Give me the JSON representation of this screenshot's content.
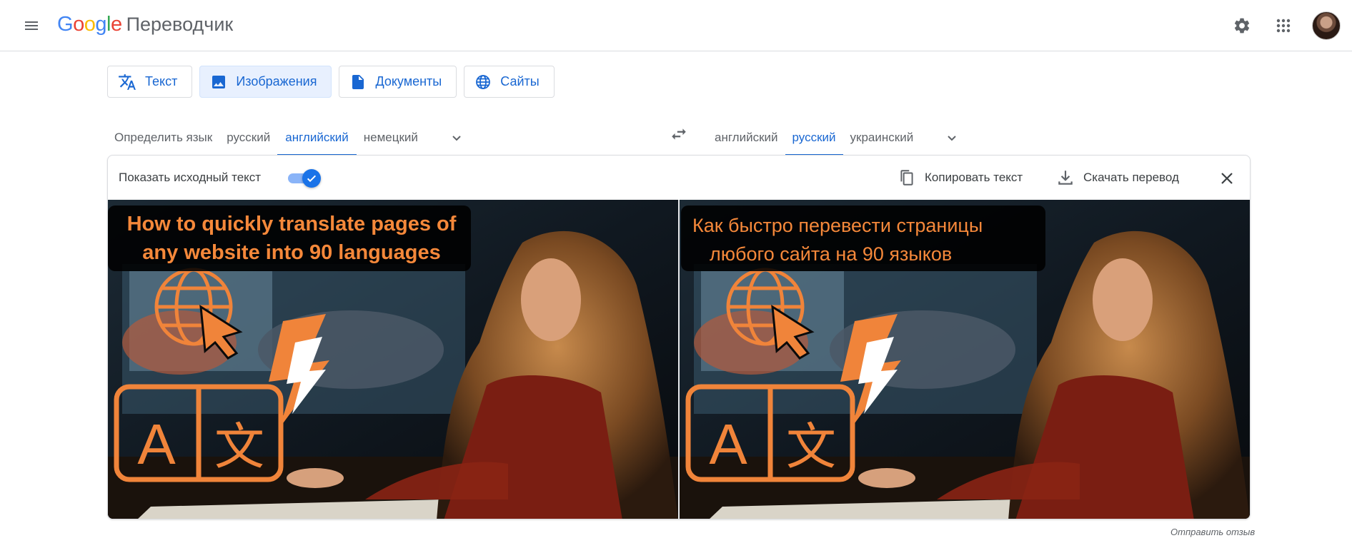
{
  "header": {
    "logo_google": "Google",
    "app_name": "Переводчик",
    "menu_icon": "hamburger-menu-icon",
    "settings_icon": "gear-icon",
    "apps_icon": "apps-grid-icon"
  },
  "modes": {
    "text": "Текст",
    "images": "Изображения",
    "documents": "Документы",
    "sites": "Сайты",
    "active": "images"
  },
  "source_langs": {
    "detect": "Определить язык",
    "lang1": "русский",
    "lang2": "английский",
    "lang3": "немецкий",
    "active": "английский"
  },
  "target_langs": {
    "lang1": "английский",
    "lang2": "русский",
    "lang3": "украинский",
    "active": "русский"
  },
  "toolbar": {
    "show_source": "Показать исходный текст",
    "show_source_on": true,
    "copy_text": "Копировать текст",
    "download": "Скачать перевод"
  },
  "images": {
    "source_caption_line1": "How to quickly translate pages of",
    "source_caption_line2": "any website into 90 languages",
    "translated_caption_line1": "Как быстро перевести страницы",
    "translated_caption_line2": "любого сайта на 90 языков",
    "icon_letter_latin": "A",
    "icon_letter_cjk": "文"
  },
  "footer": {
    "feedback": "Отправить отзыв"
  },
  "colors": {
    "accent": "#1967d2",
    "toggle": "#1a73e8",
    "caption_text": "#f5883a",
    "icon_orange": "#f0843a"
  }
}
